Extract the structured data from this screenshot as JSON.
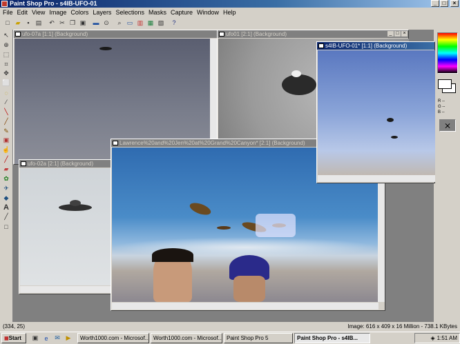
{
  "app": {
    "title": "Paint Shop Pro - s4IB-UFO-01"
  },
  "titlebar_buttons": {
    "min": "_",
    "max": "□",
    "close": "×"
  },
  "menu": [
    "File",
    "Edit",
    "View",
    "Image",
    "Colors",
    "Layers",
    "Selections",
    "Masks",
    "Capture",
    "Window",
    "Help"
  ],
  "toolbar_icons": [
    "new-icon",
    "open-icon",
    "save-icon",
    "print-icon",
    "undo-icon",
    "cut-icon",
    "copy-icon",
    "paste-icon",
    "browse-icon",
    "zoom-icon",
    "histogram-icon",
    "palette-icon",
    "overview-icon",
    "help-icon"
  ],
  "tool_icons": [
    "arrow-icon",
    "zoom-tool-icon",
    "deform-icon",
    "crop-icon",
    "mover-icon",
    "selection-icon",
    "freehand-icon",
    "magic-wand-icon",
    "dropper-icon",
    "paintbrush-icon",
    "clone-icon",
    "color-replacer-icon",
    "retouch-icon",
    "scratch-remover-icon",
    "eraser-icon",
    "picture-tube-icon",
    "airbrush-icon",
    "flood-fill-icon",
    "text-icon",
    "draw-icon",
    "shape-icon"
  ],
  "windows": {
    "w1": {
      "title": "ufo-07a [1:1] (Background)"
    },
    "w2": {
      "title": "ufo01 [2:1] (Background)"
    },
    "w3": {
      "title": "s4IB-UFO-01* [1:1] (Background)"
    },
    "w4": {
      "title": "ufo-02a [2:1] (Background)"
    },
    "w5": {
      "title": "Lawrence%20and%20Jen%20at%20Grand%20Canyon* [2:1] (Background)"
    }
  },
  "palette": {
    "rgb": "R --\nG --\nB --"
  },
  "status": {
    "coords": "(334, 25)",
    "image_info": "Image:  616 x 409 x 16 Million - 738.1 KBytes"
  },
  "taskbar": {
    "start": "Start",
    "tasks": [
      "Worth1000.com - Microsof...",
      "Worth1000.com - Microsof...",
      "Paint Shop Pro 5",
      "Paint Shop Pro - s4IB..."
    ],
    "clock": "1:51 AM"
  },
  "colors": {
    "active_title": "#0a246a",
    "inactive_title": "#808080",
    "sky": "#4a8cc8"
  }
}
